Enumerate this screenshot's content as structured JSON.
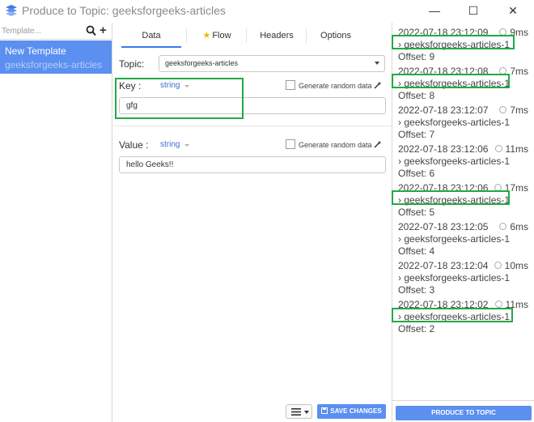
{
  "window": {
    "title": "Produce to Topic: geeksforgeeks-articles",
    "minimize_glyph": "—",
    "maximize_glyph": "☐",
    "close_glyph": "✕"
  },
  "templates": {
    "search_placeholder": "Template...",
    "add_glyph": "+",
    "items": [
      {
        "name": "New Template",
        "topic": "geeksforgeeks-articles"
      }
    ]
  },
  "tabs": [
    {
      "label": "Data",
      "active": true
    },
    {
      "label": "Flow",
      "icon": "star-icon"
    },
    {
      "label": "Headers"
    },
    {
      "label": "Options"
    }
  ],
  "form": {
    "topic_label": "Topic:",
    "topic_value": "geeksforgeeks-articles",
    "key": {
      "label": "Key :",
      "type": "string",
      "random_label": "Generate random data",
      "value": "gfg"
    },
    "value": {
      "label": "Value :",
      "type": "string",
      "random_label": "Generate random data",
      "value": "hello Geeks!!"
    },
    "save_label": "SAVE CHANGES"
  },
  "messages": [
    {
      "time": "2022-07-18 23:12:09",
      "duration": "9ms",
      "topic": "geeksforgeeks-articles-1",
      "offset": "Offset: 9"
    },
    {
      "time": "2022-07-18 23:12:08",
      "duration": "7ms",
      "topic": "geeksforgeeks-articles-1",
      "offset": "Offset: 8"
    },
    {
      "time": "2022-07-18 23:12:07",
      "duration": "7ms",
      "topic": "geeksforgeeks-articles-1",
      "offset": "Offset: 7"
    },
    {
      "time": "2022-07-18 23:12:06",
      "duration": "11ms",
      "topic": "geeksforgeeks-articles-1",
      "offset": "Offset: 6"
    },
    {
      "time": "2022-07-18 23:12:06",
      "duration": "17ms",
      "topic": "geeksforgeeks-articles-1",
      "offset": "Offset: 5"
    },
    {
      "time": "2022-07-18 23:12:05",
      "duration": "6ms",
      "topic": "geeksforgeeks-articles-1",
      "offset": "Offset: 4"
    },
    {
      "time": "2022-07-18 23:12:04",
      "duration": "10ms",
      "topic": "geeksforgeeks-articles-1",
      "offset": "Offset: 3"
    },
    {
      "time": "2022-07-18 23:12:02",
      "duration": "11ms",
      "topic": "geeksforgeeks-articles-1",
      "offset": "Offset: 2"
    }
  ],
  "produce_label": "PRODUCE TO TOPIC",
  "colors": {
    "accent": "#5b8ff0",
    "highlight": "#22aa44",
    "type_label": "#3b6ec9"
  }
}
